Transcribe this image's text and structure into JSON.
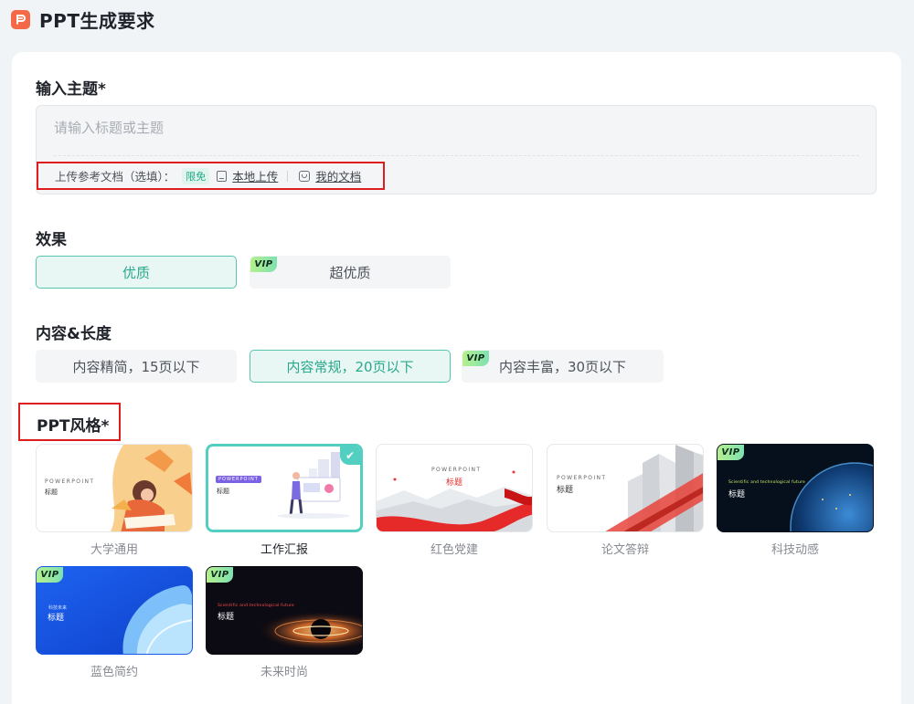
{
  "header": {
    "title": "PPT生成要求"
  },
  "topic": {
    "label": "输入主题*",
    "placeholder": "请输入标题或主题",
    "upload": {
      "label": "上传参考文档（选填）：",
      "badge": "限免",
      "local_upload": "本地上传",
      "my_docs": "我的文档"
    }
  },
  "effect": {
    "label": "效果",
    "options": [
      {
        "label": "优质",
        "selected": true,
        "vip": false
      },
      {
        "label": "超优质",
        "selected": false,
        "vip": true
      }
    ]
  },
  "content": {
    "label": "内容&长度",
    "options": [
      {
        "label": "内容精简，15页以下",
        "selected": false,
        "vip": false
      },
      {
        "label": "内容常规，20页以下",
        "selected": true,
        "vip": false
      },
      {
        "label": "内容丰富，30页以下",
        "selected": false,
        "vip": true
      }
    ]
  },
  "vip_text": "VIP",
  "style": {
    "label": "PPT风格*",
    "tiles": [
      {
        "name": "大学通用",
        "selected": false,
        "vip": false,
        "brand": "POWERPOINT",
        "title": "标题"
      },
      {
        "name": "工作汇报",
        "selected": true,
        "vip": false,
        "brand": "POWERPOINT",
        "title": "标题"
      },
      {
        "name": "红色党建",
        "selected": false,
        "vip": false,
        "brand": "POWERPOINT",
        "title": "标题"
      },
      {
        "name": "论文答辩",
        "selected": false,
        "vip": false,
        "brand": "POWERPOINT",
        "title": "标题"
      },
      {
        "name": "科技动感",
        "selected": false,
        "vip": true,
        "brand": "Scientific and technological future",
        "title": "标题"
      },
      {
        "name": "蓝色简约",
        "selected": false,
        "vip": true,
        "brand": "科技未来",
        "title": "标题"
      },
      {
        "name": "未来时尚",
        "selected": false,
        "vip": true,
        "brand": "Scientific and technological future",
        "title": "标题"
      }
    ]
  },
  "colors": {
    "accent": "#2aa88c",
    "accent_border": "#57c4ad",
    "highlight_red": "#de1e1e",
    "logo": "#f46a48"
  }
}
